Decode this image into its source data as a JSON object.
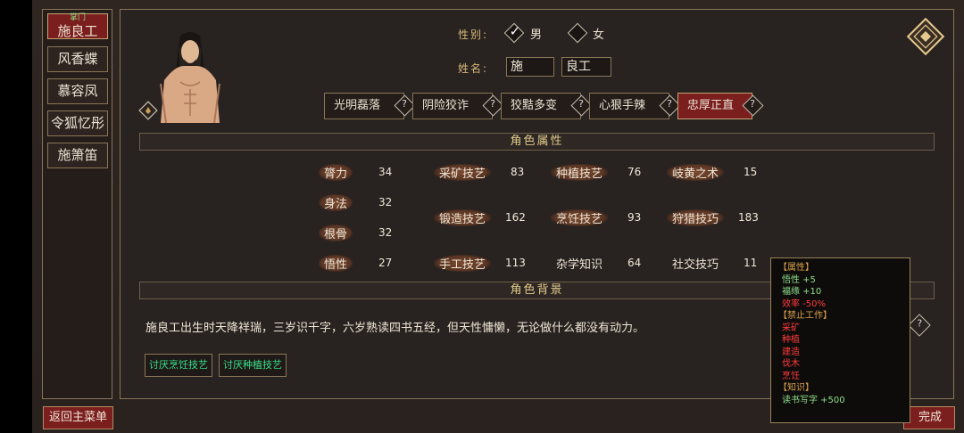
{
  "sidebar": {
    "tag": "掌门",
    "characters": [
      "施良工",
      "风香蝶",
      "慕容凤",
      "令狐忆彤",
      "施箫笛"
    ]
  },
  "gender": {
    "label": "性别:",
    "male": "男",
    "female": "女",
    "selected": "男"
  },
  "name": {
    "label": "姓名:",
    "surname": "施",
    "given": "良工"
  },
  "traits": {
    "items": [
      "光明磊落",
      "阴险狡诈",
      "狡黠多变",
      "心狠手辣",
      "忠厚正直"
    ],
    "selected": "忠厚正直",
    "help": "?"
  },
  "attributes": {
    "title": "角色属性",
    "base": [
      {
        "label": "膂力",
        "value": "34"
      },
      {
        "label": "身法",
        "value": "32"
      },
      {
        "label": "根骨",
        "value": "32"
      },
      {
        "label": "悟性",
        "value": "27"
      }
    ],
    "skills": [
      {
        "label": "采矿技艺",
        "value": "83"
      },
      {
        "label": "种植技艺",
        "value": "76"
      },
      {
        "label": "岐黄之术",
        "value": "15"
      },
      {
        "label": "锻造技艺",
        "value": "162"
      },
      {
        "label": "烹饪技艺",
        "value": "93"
      },
      {
        "label": "狩猎技巧",
        "value": "183"
      },
      {
        "label": "手工技艺",
        "value": "113"
      },
      {
        "label": "杂学知识",
        "value": "64"
      },
      {
        "label": "社交技巧",
        "value": "11"
      }
    ]
  },
  "background": {
    "title": "角色背景",
    "text": "施良工出生时天降祥瑞，三岁识千字，六岁熟读四书五经，但天性慵懒，无论做什么都没有动力。",
    "tags": [
      "讨厌烹饪技艺",
      "讨厌种植技艺"
    ]
  },
  "tooltip": {
    "attr_header": "【属性】",
    "attrs": [
      "悟性 +5",
      "福缘 +10",
      "效率 -50%"
    ],
    "banned_header": "【禁止工作】",
    "banned": [
      "采矿",
      "种植",
      "建造",
      "伐木",
      "烹饪"
    ],
    "knowledge_header": "【知识】",
    "knowledge": "读书写字 +500"
  },
  "buttons": {
    "back": "返回主菜单",
    "done": "完成"
  },
  "colors": {
    "accent_red": "#7a1e1e",
    "gold": "#d6b878",
    "frame": "#8a7656",
    "tag_green": "#37e08a"
  }
}
